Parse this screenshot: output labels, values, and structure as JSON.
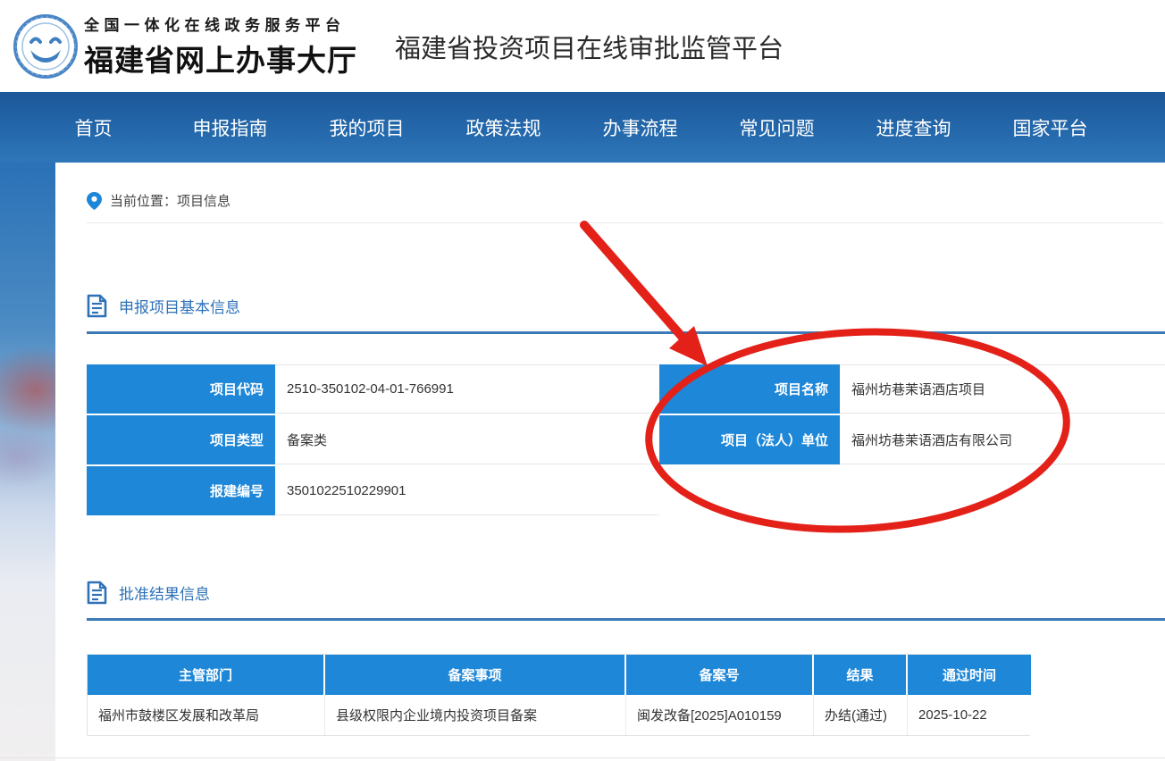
{
  "header": {
    "logo": {
      "icon": "smiley-government-emblem",
      "line1": "全国一体化在线政务服务平台",
      "line2": "福建省网上办事大厅"
    },
    "title": "福建省投资项目在线审批监管平台"
  },
  "nav": {
    "items": [
      {
        "label": "首页"
      },
      {
        "label": "申报指南"
      },
      {
        "label": "我的项目"
      },
      {
        "label": "政策法规"
      },
      {
        "label": "办事流程"
      },
      {
        "label": "常见问题"
      },
      {
        "label": "进度查询"
      },
      {
        "label": "国家平台"
      }
    ]
  },
  "breadcrumb": {
    "text": "当前位置：项目信息"
  },
  "basic_info": {
    "title": "申报项目基本信息",
    "fields_left": [
      {
        "label": "项目代码",
        "value": "2510-350102-04-01-766991"
      },
      {
        "label": "项目类型",
        "value": "备案类"
      },
      {
        "label": "报建编号",
        "value": "3501022510229901"
      }
    ],
    "fields_right": [
      {
        "label": "项目名称",
        "value": "福州坊巷茉语酒店项目"
      },
      {
        "label": "项目（法人）单位",
        "value": "福州坊巷茉语酒店有限公司"
      }
    ]
  },
  "approval_result": {
    "title": "批准结果信息",
    "headers": [
      "主管部门",
      "备案事项",
      "备案号",
      "结果",
      "通过时间"
    ],
    "rows": [
      {
        "dept": "福州市鼓楼区发展和改革局",
        "item": "县级权限内企业境内投资项目备案",
        "record_no": "闽发改备[2025]A010159",
        "result": "办结(通过)",
        "pass_date": "2025-10-22"
      }
    ]
  },
  "annotation": {
    "type": "red arrow pointing at red ellipse highlighting project name and legal-entity rows",
    "color": "#e32119"
  },
  "colors": {
    "accent_blue": "#1e87d8",
    "nav_blue": "#2468ab",
    "section_blue": "#2e71b8",
    "annotation_red": "#e32119"
  }
}
